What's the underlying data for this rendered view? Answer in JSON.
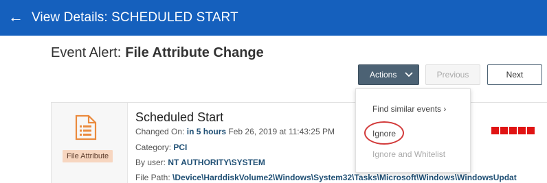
{
  "header": {
    "back_icon": "back-arrow-icon",
    "title": "View Details: SCHEDULED START",
    "bg_color": "#1560bd"
  },
  "alert": {
    "prefix": "Event Alert:",
    "name": "File Attribute Change"
  },
  "toolbar": {
    "actions_label": "Actions",
    "actions_chevron": "chevron-down-icon",
    "previous_label": "Previous",
    "next_label": "Next"
  },
  "actions_menu": {
    "find_similar": "Find similar events",
    "ignore": "Ignore",
    "ignore_whitelist": "Ignore and Whitelist"
  },
  "event": {
    "tag": "File Attribute",
    "name": "Scheduled Start",
    "changed_on_label": "Changed On:",
    "changed_on_relative": "in 5 hours",
    "changed_on_date": "Feb 26, 2019 at 11:43:25 PM",
    "category_label": "Category:",
    "category": "PCI",
    "user_label": "By user:",
    "user": "NT AUTHORITY\\SYSTEM",
    "file_path_label": "File Path:",
    "file_path": "\\Device\\HarddiskVolume2\\Windows\\System32\\Tasks\\Microsoft\\Windows\\WindowsUpdat",
    "severity_color": "#e01414",
    "severity_level": 5
  }
}
